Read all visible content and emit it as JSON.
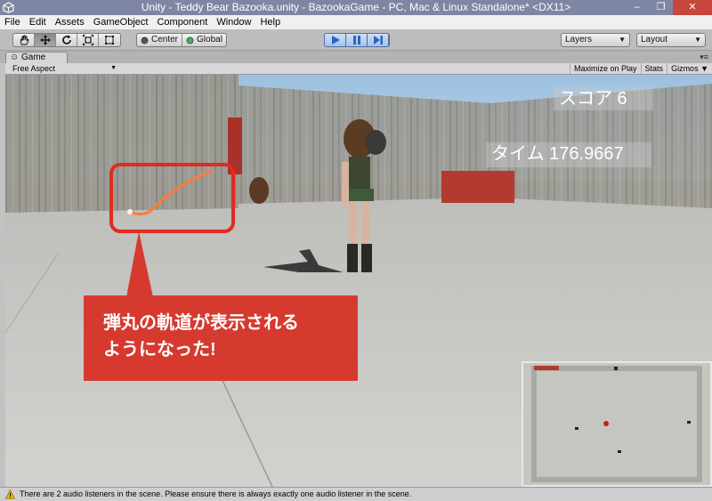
{
  "window": {
    "title": "Unity - Teddy Bear Bazooka.unity - BazookaGame - PC, Mac & Linux Standalone* <DX11>",
    "min_glyph": "–",
    "max_glyph": "❐",
    "close_glyph": "✕"
  },
  "menu": [
    "File",
    "Edit",
    "Assets",
    "GameObject",
    "Component",
    "Window",
    "Help"
  ],
  "toolbar": {
    "pivot_label": "Center",
    "space_label": "Global",
    "layers_label": "Layers",
    "layout_label": "Layout"
  },
  "game_tab": {
    "label": "Game",
    "aspect": "Free Aspect",
    "maximize_label": "Maximize on Play",
    "stats_label": "Stats",
    "gizmos_label": "Gizmos"
  },
  "hud": {
    "score": "スコア 6",
    "time": "タイム 176.9667"
  },
  "callout": {
    "line1": "弾丸の軌道が表示される",
    "line2": "ようになった!"
  },
  "status": {
    "message": "There are 2 audio listeners in the scene. Please ensure there is always exactly one audio listener in the scene."
  },
  "colors": {
    "callout_red": "#d63a2f",
    "titlebar": "#7f86a3",
    "play_blue": "#2a64c8"
  }
}
